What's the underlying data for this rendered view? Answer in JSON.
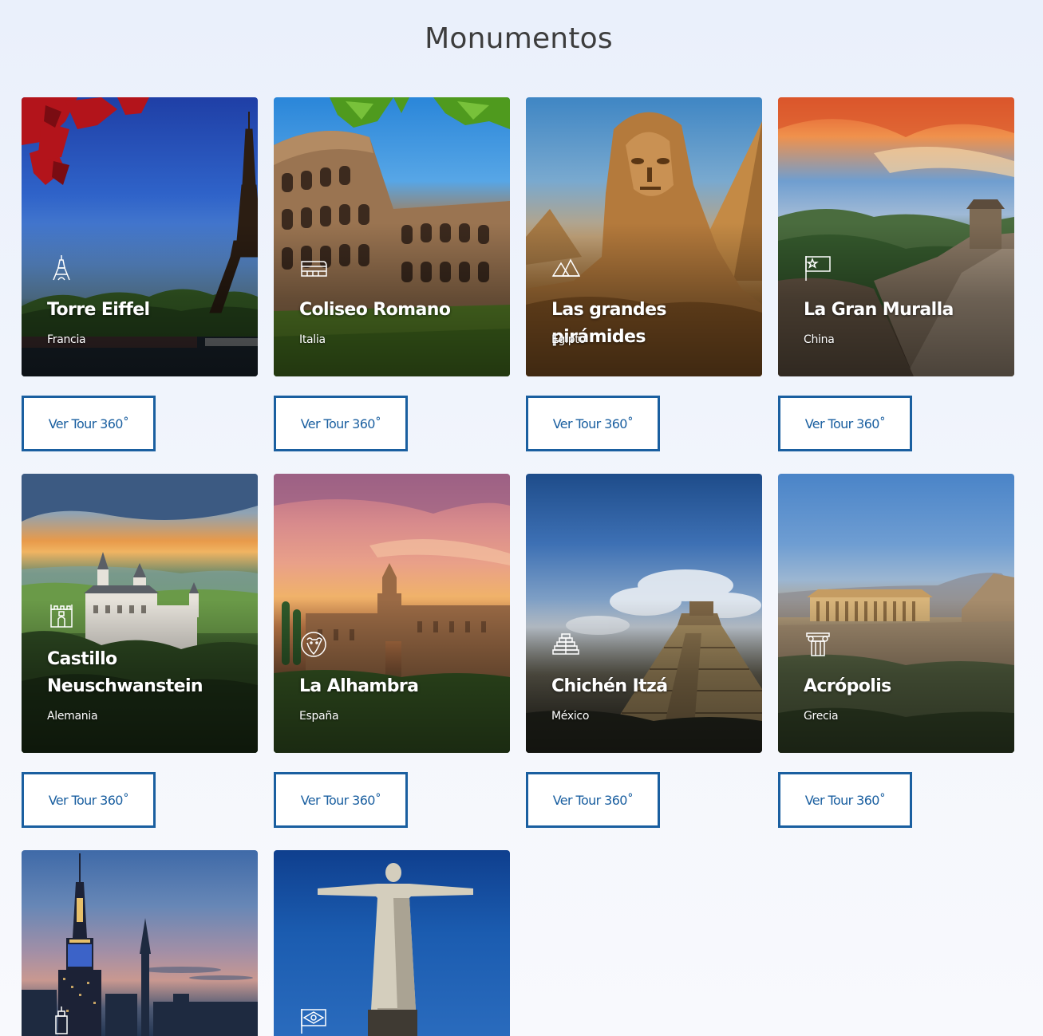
{
  "page": {
    "title": "Monumentos"
  },
  "colors": {
    "accent": "#1a5fa0",
    "background": "#eef2fb",
    "title": "#3d3d3d"
  },
  "monuments": [
    {
      "name": "Torre Eiffel",
      "country": "Francia",
      "button": "Ver Tour 360˚",
      "icon": "eiffel-tower-icon"
    },
    {
      "name": "Coliseo Romano",
      "country": "Italia",
      "button": "Ver Tour 360˚",
      "icon": "colosseum-icon"
    },
    {
      "name": "Las grandes pirámides",
      "country": "Egipto",
      "button": "Ver Tour 360˚",
      "icon": "pyramids-icon"
    },
    {
      "name": "La Gran Muralla",
      "country": "China",
      "button": "Ver Tour 360˚",
      "icon": "china-flag-icon"
    },
    {
      "name": "Castillo Neuschwanstein",
      "country": "Alemania",
      "button": "Ver Tour 360˚",
      "icon": "castle-icon"
    },
    {
      "name": "La Alhambra",
      "country": "España",
      "button": "Ver Tour 360˚",
      "icon": "bull-icon"
    },
    {
      "name": "Chichén Itzá",
      "country": "México",
      "button": "Ver Tour 360˚",
      "icon": "mayan-pyramid-icon"
    },
    {
      "name": "Acrópolis",
      "country": "Grecia",
      "button": "Ver Tour 360˚",
      "icon": "greek-column-icon"
    },
    {
      "name": "",
      "country": "",
      "button": "",
      "icon": "skyscraper-icon"
    },
    {
      "name": "",
      "country": "",
      "button": "",
      "icon": "brazil-flag-icon"
    }
  ]
}
